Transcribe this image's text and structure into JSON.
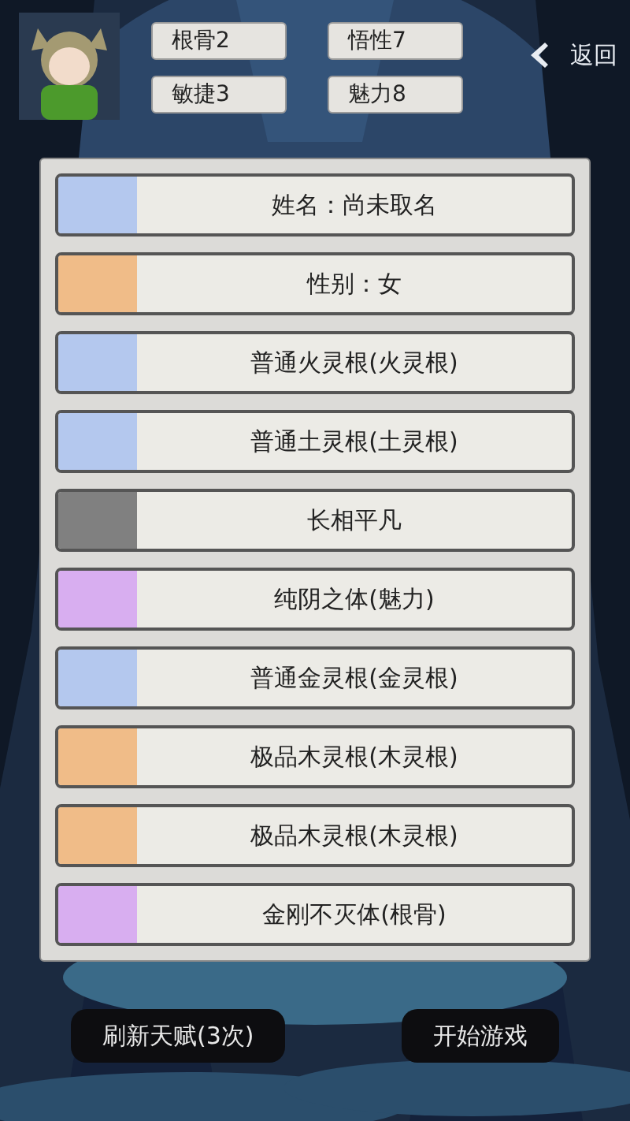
{
  "stats": [
    {
      "label": "根骨2"
    },
    {
      "label": "悟性7"
    },
    {
      "label": "敏捷3"
    },
    {
      "label": "魅力8"
    }
  ],
  "back": {
    "label": "返回"
  },
  "talents": [
    {
      "label": "姓名：尚未取名",
      "color": "#b4c8ee"
    },
    {
      "label": "性别：女",
      "color": "#f0bc88"
    },
    {
      "label": "普通火灵根(火灵根)",
      "color": "#b4c8ee"
    },
    {
      "label": "普通土灵根(土灵根)",
      "color": "#b4c8ee"
    },
    {
      "label": "长相平凡",
      "color": "#808080"
    },
    {
      "label": "纯阴之体(魅力)",
      "color": "#d8aef0"
    },
    {
      "label": "普通金灵根(金灵根)",
      "color": "#b4c8ee"
    },
    {
      "label": "极品木灵根(木灵根)",
      "color": "#f0bc88"
    },
    {
      "label": "极品木灵根(木灵根)",
      "color": "#f0bc88"
    },
    {
      "label": "金刚不灭体(根骨)",
      "color": "#d8aef0"
    }
  ],
  "buttons": [
    {
      "label": "刷新天赋(3次)"
    },
    {
      "label": "开始游戏"
    }
  ]
}
